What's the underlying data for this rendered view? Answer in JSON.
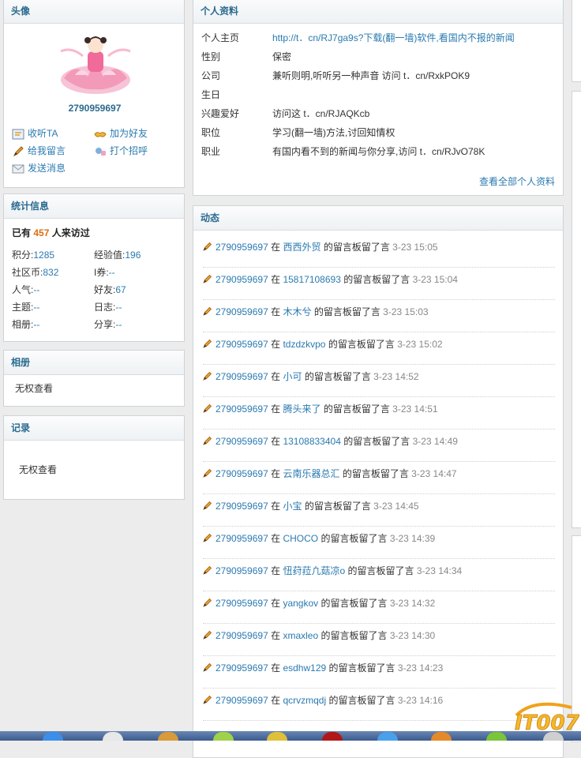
{
  "avatar_panel": {
    "title": "头像",
    "username": "2790959697",
    "actions": [
      {
        "label": "收听TA",
        "icon": "listen-icon"
      },
      {
        "label": "加为好友",
        "icon": "handshake-icon"
      },
      {
        "label": "给我留言",
        "icon": "pencil-icon"
      },
      {
        "label": "打个招呼",
        "icon": "greet-icon"
      },
      {
        "label": "发送消息",
        "icon": "envelope-icon"
      }
    ]
  },
  "stats_panel": {
    "title": "统计信息",
    "visit_prefix": "已有",
    "visit_count": "457",
    "visit_suffix": "人来访过",
    "items": [
      {
        "label": "积分:",
        "value": "1285"
      },
      {
        "label": "经验值:",
        "value": "196"
      },
      {
        "label": "社区币:",
        "value": "832"
      },
      {
        "label": "I券:",
        "value": "--"
      },
      {
        "label": "人气:",
        "value": "--"
      },
      {
        "label": "好友:",
        "value": "67"
      },
      {
        "label": "主题:",
        "value": "--"
      },
      {
        "label": "日志:",
        "value": "--"
      },
      {
        "label": "相册:",
        "value": "--"
      },
      {
        "label": "分享:",
        "value": "--"
      }
    ]
  },
  "album_panel": {
    "title": "相册",
    "text": "无权查看"
  },
  "record_panel": {
    "title": "记录",
    "text": "无权查看"
  },
  "profile_panel": {
    "title": "个人资料",
    "rows": [
      {
        "key": "个人主页",
        "value": "http://t．cn/RJ7ga9s?下载(翻一墙)软件,看国内不报的新闻"
      },
      {
        "key": "性别",
        "value": "保密"
      },
      {
        "key": "公司",
        "value": "兼听则明,听听另一种声音 访问 t．cn/RxkPOK9"
      },
      {
        "key": "生日",
        "value": ""
      },
      {
        "key": "兴趣爱好",
        "value": "访问这 t．cn/RJAQKcb"
      },
      {
        "key": "职位",
        "value": "学习(翻一墙)方法,讨回知情权"
      },
      {
        "key": "职业",
        "value": "有国内看不到的新闻与你分享,访问 t．cn/RJvO78K"
      }
    ],
    "more_link": "查看全部个人资料"
  },
  "feed_panel": {
    "title": "动态",
    "items": [
      {
        "user": "2790959697",
        "in": "在",
        "target": "西西外贸",
        "action": "的留言板留了言",
        "time": "3-23 15:05"
      },
      {
        "user": "2790959697",
        "in": "在",
        "target": "15817108693",
        "action": "的留言板留了言",
        "time": "3-23 15:04"
      },
      {
        "user": "2790959697",
        "in": "在",
        "target": "木木兮",
        "action": "的留言板留了言",
        "time": "3-23 15:03"
      },
      {
        "user": "2790959697",
        "in": "在",
        "target": "tdzdzkvpo",
        "action": "的留言板留了言",
        "time": "3-23 15:02"
      },
      {
        "user": "2790959697",
        "in": "在",
        "target": "小可",
        "action": "的留言板留了言",
        "time": "3-23 14:52"
      },
      {
        "user": "2790959697",
        "in": "在",
        "target": "腾头来了",
        "action": "的留言板留了言",
        "time": "3-23 14:51"
      },
      {
        "user": "2790959697",
        "in": "在",
        "target": "13108833404",
        "action": "的留言板留了言",
        "time": "3-23 14:49"
      },
      {
        "user": "2790959697",
        "in": "在",
        "target": "云南乐器总汇",
        "action": "的留言板留了言",
        "time": "3-23 14:47"
      },
      {
        "user": "2790959697",
        "in": "在",
        "target": "小宝",
        "action": "的留言板留了言",
        "time": "3-23 14:45"
      },
      {
        "user": "2790959697",
        "in": "在",
        "target": "CHOCO",
        "action": "的留言板留了言",
        "time": "3-23 14:39"
      },
      {
        "user": "2790959697",
        "in": "在",
        "target": "忸荮菈凢菇凉o",
        "action": "的留言板留了言",
        "time": "3-23 14:34"
      },
      {
        "user": "2790959697",
        "in": "在",
        "target": "yangkov",
        "action": "的留言板留了言",
        "time": "3-23 14:32"
      },
      {
        "user": "2790959697",
        "in": "在",
        "target": "xmaxleo",
        "action": "的留言板留了言",
        "time": "3-23 14:30"
      },
      {
        "user": "2790959697",
        "in": "在",
        "target": "esdhw129",
        "action": "的留言板留了言",
        "time": "3-23 14:23"
      },
      {
        "user": "2790959697",
        "in": "在",
        "target": "qcrvzmqdj",
        "action": "的留言板留了言",
        "time": "3-23 14:16"
      }
    ]
  },
  "watermark": {
    "text": "IT007"
  }
}
